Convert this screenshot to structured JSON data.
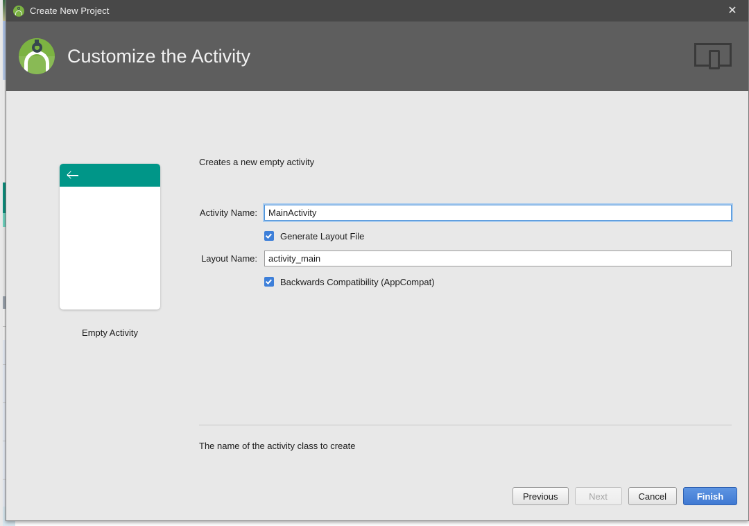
{
  "background_app": {
    "name": "background-window"
  },
  "window": {
    "title": "Create New Project",
    "title_icon": "android-studio-icon",
    "close_label": "✕"
  },
  "header": {
    "title": "Customize the Activity",
    "logo": "android-studio-logo",
    "device_icon": "tablet-and-phone-icon"
  },
  "preview": {
    "back_icon": "back-arrow-icon",
    "label": "Empty Activity",
    "accent_color": "#009688"
  },
  "main": {
    "description": "Creates a new empty activity",
    "fields": [
      {
        "label": "Activity Name:",
        "value": "MainActivity",
        "focused": true
      },
      {
        "label": "Layout Name:",
        "value": "activity_main",
        "focused": false
      }
    ],
    "checkboxes": [
      {
        "label": "Generate Layout File",
        "checked": true
      },
      {
        "label": "Backwards Compatibility (AppCompat)",
        "checked": true
      }
    ],
    "hint": "The name of the activity class to create"
  },
  "footer": {
    "buttons": [
      {
        "label": "Previous",
        "state": "enabled"
      },
      {
        "label": "Next",
        "state": "disabled"
      },
      {
        "label": "Cancel",
        "state": "enabled"
      },
      {
        "label": "Finish",
        "state": "primary"
      }
    ]
  },
  "colors": {
    "titlebar": "#484848",
    "header": "#5e5e5e",
    "body": "#e8e8e8",
    "accent_blue": "#3d7fd9",
    "teal": "#009688",
    "green": "#7cb342"
  }
}
